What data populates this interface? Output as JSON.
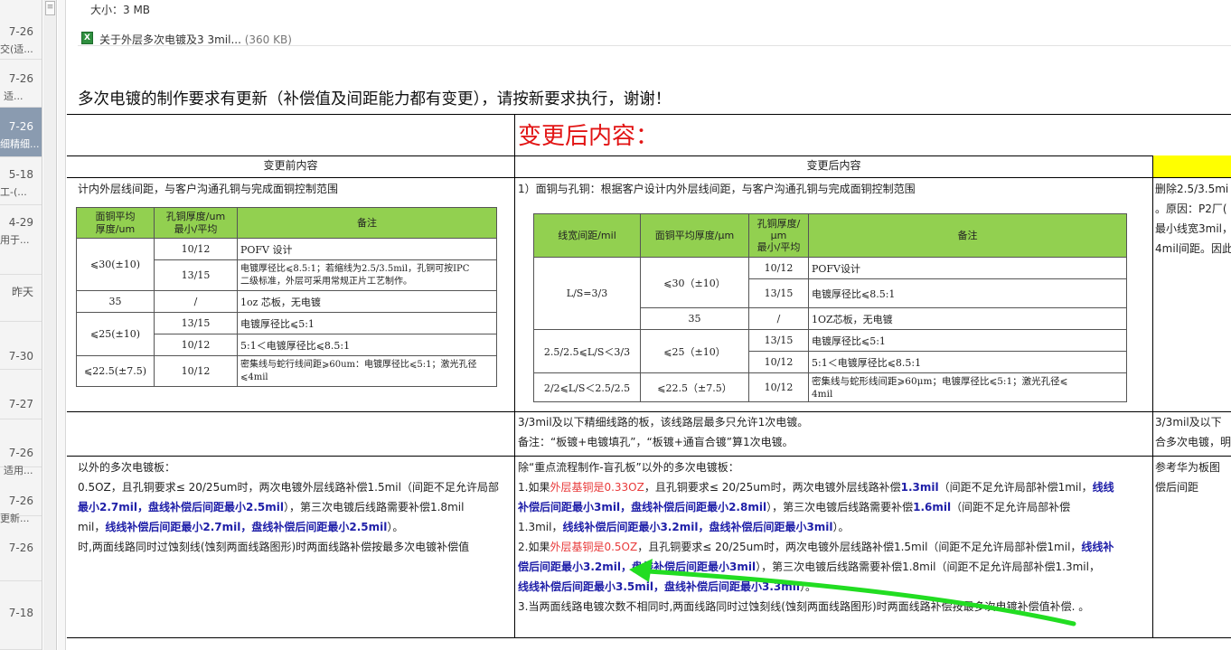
{
  "sidebar": {
    "items": [
      {
        "date": "7-26",
        "sub": "交(适...",
        "selected": false
      },
      {
        "date": "7-26",
        "sub": "适...",
        "selected": false
      },
      {
        "date": "7-26",
        "sub": "细精细...",
        "selected": true
      },
      {
        "date": "5-18",
        "sub": "工-(...",
        "selected": false
      },
      {
        "date": "4-29",
        "sub": "用于...",
        "selected": false
      },
      {
        "date": "昨天",
        "sub": "",
        "selected": false
      },
      {
        "date": "7-30",
        "sub": "",
        "selected": false
      },
      {
        "date": "7-27",
        "sub": "",
        "selected": false
      },
      {
        "date": "7-26",
        "sub": "适用...",
        "selected": false
      },
      {
        "date": "7-26",
        "sub": "更新...",
        "selected": false
      },
      {
        "date": "7-26",
        "sub": "",
        "selected": false
      },
      {
        "date": "7-18",
        "sub": "",
        "selected": false
      }
    ]
  },
  "scroll_glyph": "≡",
  "attachment": {
    "size_label": "大小：3 MB",
    "icon_label": "X",
    "file_name": "关于外层多次电镀及3 3mil...",
    "file_size": "(360 KB)"
  },
  "notice": "多次电镀的制作要求有更新（补偿值及间距能力都有变更），请按新要求执行，谢谢！",
  "table": {
    "big_header": "变更后内容：",
    "col_before": "变更前内容",
    "col_after": "变更后内容",
    "r1_before": "计内外层线间距，与客户沟通孔铜与完成面铜控制范围",
    "r1_after": "1）面铜与孔铜：根据客户设计内外层线间距，与客户沟通孔铜与完成面铜控制范围",
    "r1_right": [
      "删除2.5/3.5mi",
      "。原因：P2厂(",
      "最小线宽3mil，",
      "4mil间距。因此"
    ],
    "r2_after": [
      "3/3mil及以下精细线路的板，该线路层最多只允许1次电镀。",
      "备注：“板镀+电镀填孔”，“板镀+通盲合镀”算1次电镀。"
    ],
    "r2_right": [
      "3/3mil及以下",
      "合多次电镀，明"
    ],
    "r3_right": [
      "参考华为板图",
      "偿后间距"
    ]
  },
  "old_table": {
    "headers": [
      "面铜平均\n厚度/um",
      "孔铜厚度/um\n最小/平均",
      "备注"
    ],
    "rows": [
      {
        "a": "⩽30(±10)",
        "b": "10/12",
        "c": "POFV 设计"
      },
      {
        "b": "13/15",
        "c": "电镀厚径比⩽8.5:1；若缩线为2.5/3.5mil，孔铜可按IPC\n二级标准，外层可采用常规正片工艺制作。"
      },
      {
        "a": "35",
        "b": "/",
        "c": "1oz 芯板，无电镀"
      },
      {
        "a": "⩽25(±10)",
        "b": "13/15",
        "c": "电镀厚径比⩽5:1"
      },
      {
        "b": "10/12",
        "c": "5:1＜电镀厚径比⩽8.5:1"
      },
      {
        "a": "⩽22.5(±7.5)",
        "b": "10/12",
        "c": "密集线与蛇行线间距⩾60um：电镀厚径比⩽5:1；激光孔径\n⩽4mil"
      }
    ]
  },
  "new_table": {
    "headers": [
      "线宽间距/mil",
      "面铜平均厚度/μm",
      "孔铜厚度/\nμm\n最小/平均",
      "备注"
    ],
    "rows": [
      {
        "ls": "L/S=3/3",
        "cu": "⩽30（±10）",
        "b": "10/12",
        "c": "POFV设计"
      },
      {
        "b": "13/15",
        "c": "电镀厚径比⩽8.5:1"
      },
      {
        "cu": "35",
        "b": "/",
        "c": "1OZ芯板，无电镀"
      },
      {
        "ls": "2.5/2.5⩽L/S＜3/3",
        "cu": "⩽25（±10）",
        "b": "13/15",
        "c": "电镀厚径比⩽5:1"
      },
      {
        "b": "10/12",
        "c": "5:1＜电镀厚径比⩽8.5:1"
      },
      {
        "ls": "2/2⩽L/S＜2.5/2.5",
        "cu": "⩽22.5（±7.5）",
        "b": "10/12",
        "c": "密集线与蛇形线间距⩾60μm；电镀厚径比⩽5:1；激光孔径⩽\n4mil"
      }
    ]
  },
  "r3_before": {
    "l1": "以外的多次电镀板：",
    "l2": "0.5OZ，且孔铜要求≤ 20/25um时，两次电镀外层线路补偿1.5mil（间距不足允许局部",
    "l3a": "最小2.7mil，盘线补偿后间距最小2.5mil",
    "l3b": "），第三次电镀后线路需要补偿1.8mil",
    "l4a": "mil，",
    "l4b": "线线补偿后间距最小2.7mil，盘线补偿后间距最小2.5mil",
    "l4c": "）。",
    "l5": "时,两面线路同时过蚀刻线(蚀刻两面线路图形)时两面线路补偿按最多次电镀补偿值"
  },
  "r3_after": {
    "l1": "除“重点流程制作-盲孔板”以外的多次电镀板：",
    "l2a": "1.如果",
    "l2b": "外层基铜是0.33OZ",
    "l2c": "，且孔铜要求≤ 20/25um时，两次电镀外层线路补偿",
    "l2d": "1.3mil",
    "l2e": "（间距不足允许局部补偿1mil，",
    "l2f": "线线",
    "l3a": "补偿后间距最小3mil，盘线补偿后间距最小2.8mil",
    "l3b": "），第三次电镀后线路需要补偿",
    "l3c": "1.6mil",
    "l3d": "（间距不足允许局部补偿",
    "l4a": "1.3mil，",
    "l4b": "线线补偿后间距最小3.2mil，盘线补偿后间距最小3mil",
    "l4c": "）。",
    "l5a": "2.如果",
    "l5b": "外层基铜是0.5OZ",
    "l5c": "，且孔铜要求≤ 20/25um时，两次电镀外层线路补偿1.5mil（间距不足允许局部补偿1mil，",
    "l5d": "线线补",
    "l6a": "偿后间距最小3.2mil，盘线补偿后间距最小3mil",
    "l6b": "），第三次电镀后线路需要补偿1.8mil（间距不足允许局部补偿1.3mil，",
    "l7a": "线线补偿后间距最小3.5mil，盘线补偿后间距最小3.3mil",
    "l7b": "）。",
    "l8": "3.当两面线路电镀次数不相同时,两面线路同时过蚀刻线(蚀刻两面线路图形)时两面线路补偿按最多次电镀补偿值补偿. 。"
  },
  "colors": {
    "accent_red": "#e21414",
    "highlight_yellow": "#ffff00",
    "table_header_green": "#92d050",
    "emphasis_blue": "#1f1fa8",
    "annotation_green": "#22dd22"
  }
}
